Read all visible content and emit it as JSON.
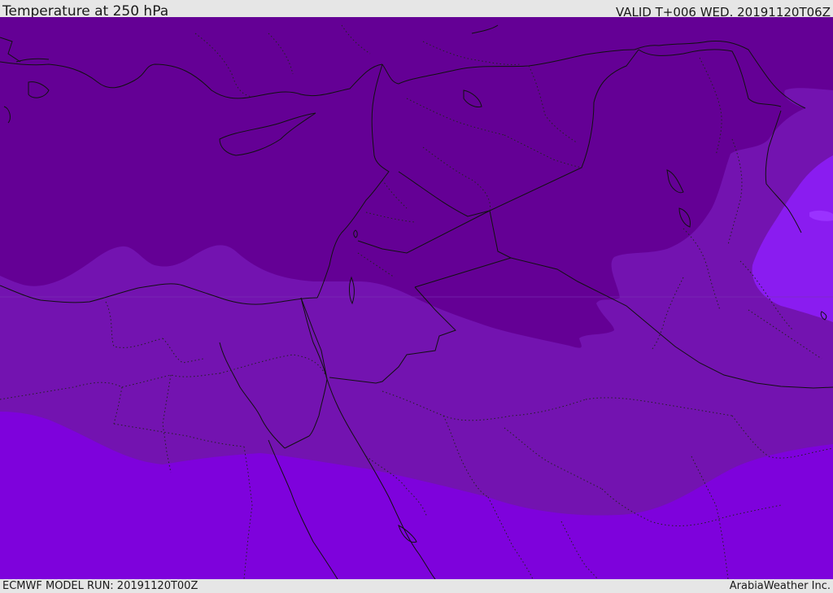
{
  "header": {
    "title": "Temperature at 250 hPa",
    "valid": "VALID T+006 WED. 20191120T06Z"
  },
  "footer": {
    "model_run": "ECMWF MODEL RUN: 20191120T00Z",
    "credit": "ArabiaWeather Inc."
  },
  "colors": {
    "coldest_band": "#640095",
    "middle_band": "#7313b0",
    "warm_band": "#7e02dc",
    "warmest_patch": "#8a1cf0",
    "borders": "#111111"
  }
}
